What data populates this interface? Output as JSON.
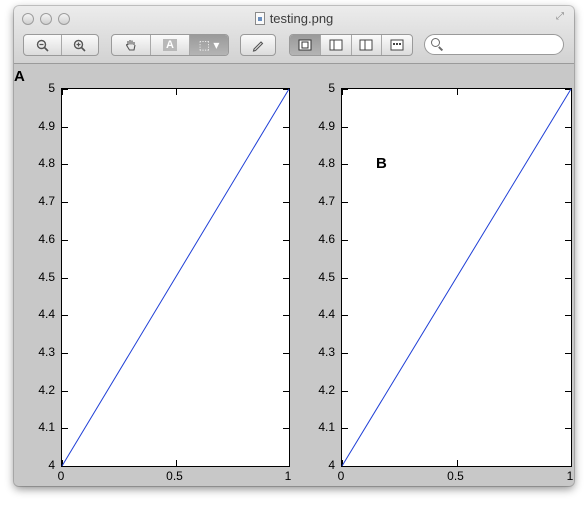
{
  "window": {
    "title": "testing.png"
  },
  "toolbar": {
    "zoom_out_icon": "zoom-out-icon",
    "zoom_in_icon": "zoom-in-icon",
    "hand_icon": "hand-icon",
    "text_select_label": "A",
    "select_label": "⬚ ▾",
    "annotate_icon": "pencil-icon",
    "view_icons": [
      "view-single-icon",
      "view-sidebar-icon",
      "view-split-icon",
      "view-contact-icon"
    ],
    "search_placeholder": ""
  },
  "figure": {
    "panel_a_label": "A",
    "panel_b_label": "B"
  },
  "chart_data": [
    {
      "type": "line",
      "title": "",
      "xlabel": "",
      "ylabel": "",
      "xlim": [
        0,
        1
      ],
      "ylim": [
        4,
        5
      ],
      "xticks": [
        "0",
        "0.5",
        "1"
      ],
      "yticks": [
        "4",
        "4.1",
        "4.2",
        "4.3",
        "4.4",
        "4.5",
        "4.6",
        "4.7",
        "4.8",
        "4.9",
        "5"
      ],
      "series": [
        {
          "x": [
            0,
            1
          ],
          "y": [
            4,
            5
          ],
          "color": "#1f3fd6"
        }
      ],
      "grid": false
    },
    {
      "type": "line",
      "title": "",
      "xlabel": "",
      "ylabel": "",
      "xlim": [
        0,
        1
      ],
      "ylim": [
        4,
        5
      ],
      "xticks": [
        "0",
        "0.5",
        "1"
      ],
      "yticks": [
        "4",
        "4.1",
        "4.2",
        "4.3",
        "4.4",
        "4.5",
        "4.6",
        "4.7",
        "4.8",
        "4.9",
        "5"
      ],
      "series": [
        {
          "x": [
            0,
            1
          ],
          "y": [
            4,
            5
          ],
          "color": "#1f3fd6"
        }
      ],
      "grid": false
    }
  ]
}
